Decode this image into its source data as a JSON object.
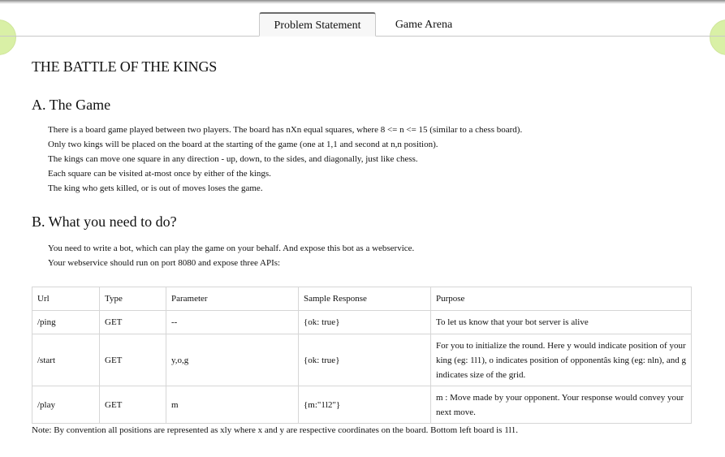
{
  "tabs": {
    "problem": "Problem Statement",
    "arena": "Game Arena"
  },
  "title": "THE BATTLE OF THE KINGS",
  "section_a": {
    "heading": "A. The Game",
    "lines": [
      "There is a board game played between two players. The board has nXn equal squares, where 8 <= n <= 15 (similar to a chess board).",
      "Only two kings will be placed on the board at the starting of the game (one at 1,1 and second at n,n position).",
      "The kings can move one square in any direction - up, down, to the sides, and diagonally, just like chess.",
      "Each square can be visited at-most once by either of the kings.",
      "The king who gets killed, or is out of moves loses the game."
    ]
  },
  "section_b": {
    "heading": "B. What you need to do?",
    "lines": [
      "You need to write a bot, which can play the game on your behalf. And expose this bot as a webservice.",
      "Your webservice should run on port 8080 and expose three APIs:"
    ]
  },
  "api_table": {
    "headers": [
      "Url",
      "Type",
      "Parameter",
      "Sample Response",
      "Purpose"
    ],
    "rows": [
      [
        "/ping",
        "GET",
        "--",
        "{ok: true}",
        "To let us know that your bot server is alive"
      ],
      [
        "/start",
        "GET",
        "y,o,g",
        "{ok: true}",
        "For you to initialize the round. Here y would indicate position of your king (eg: 1l1), o indicates position of opponentâs king (eg: nln), and g indicates size of the grid."
      ],
      [
        "/play",
        "GET",
        "m",
        "{m:\"1l2\"}",
        "m : Move made by your opponent. Your response would convey your next move."
      ]
    ]
  },
  "note": "Note: By convention all positions are represented as xly where x and y are respective coordinates on the board. Bottom left board is 1l1."
}
